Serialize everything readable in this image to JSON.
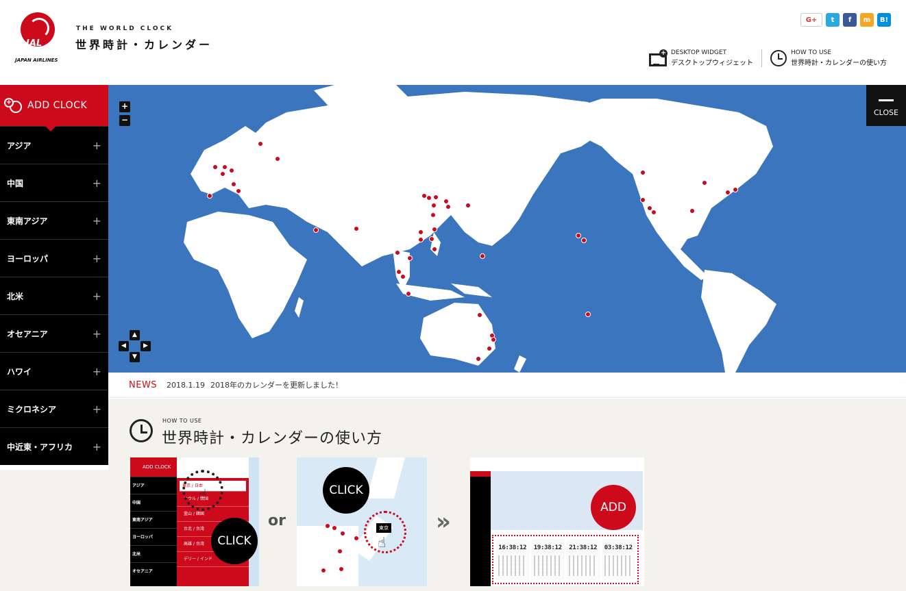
{
  "header": {
    "logo_text": "JAL",
    "logo_sub": "JAPAN AIRLINES",
    "title_en": "THE WORLD CLOCK",
    "title_jp": "世界時計・カレンダー",
    "social": [
      "G+",
      "t",
      "f",
      "m",
      "B!"
    ],
    "links": [
      {
        "en": "DESKTOP WIDGET",
        "jp": "デスクトップウィジェット",
        "icon": "monitor-plus-icon"
      },
      {
        "en": "HOW TO USE",
        "jp": "世界時計・カレンダーの使い方",
        "icon": "clock-icon"
      }
    ]
  },
  "sidebar": {
    "add_clock": "ADD CLOCK",
    "regions": [
      "アジア",
      "中国",
      "東南アジア",
      "ヨーロッパ",
      "北米",
      "オセアニア",
      "ハワイ",
      "ミクロネシア",
      "中近東・アフリカ"
    ]
  },
  "map": {
    "zoom_in": "+",
    "zoom_out": "−",
    "close": "CLOSE",
    "ocean_color": "#3b75be",
    "marker_color": "#cc0a1c"
  },
  "news": {
    "label": "NEWS",
    "date": "2018.1.19",
    "text": "2018年のカレンダーを更新しました！"
  },
  "howto": {
    "title_en": "HOW TO USE",
    "title_jp": "世界時計・カレンダーの使い方",
    "or_text": "or",
    "click_label": "CLICK",
    "add_label": "ADD",
    "step1": {
      "add_clock": "ADD CLOCK",
      "regions": [
        "アジア",
        "中国",
        "東南アジア",
        "ヨーロッパ",
        "北米",
        "オセアニア"
      ],
      "cities": [
        "東京 / 日本",
        "ソウル / 韓国",
        "釜山 / 韓国",
        "台北 / 台湾",
        "高雄 / 台湾",
        "デリー / インド"
      ]
    },
    "step2": {
      "tag": "東京"
    },
    "step3": {
      "times": [
        "16:38:12",
        "19:38:12",
        "21:38:12",
        "03:38:12"
      ]
    }
  },
  "colors": {
    "brand_red": "#cc0a1c",
    "dark": "#000000"
  }
}
